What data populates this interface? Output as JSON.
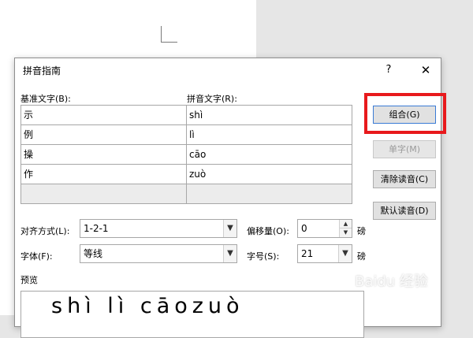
{
  "dialog": {
    "title": "拼音指南",
    "help": "?",
    "close": "✕"
  },
  "headers": {
    "base": "基准文字(B):",
    "pinyin": "拼音文字(R):"
  },
  "rows": [
    {
      "base": "示",
      "pinyin": "shì"
    },
    {
      "base": "例",
      "pinyin": "lì"
    },
    {
      "base": "操",
      "pinyin": "cāo"
    },
    {
      "base": "作",
      "pinyin": "zuò"
    },
    {
      "base": "",
      "pinyin": ""
    }
  ],
  "buttons": {
    "combine": "组合(G)",
    "single": "单字(M)",
    "clear": "清除读音(C)",
    "default": "默认读音(D)"
  },
  "form": {
    "align_label": "对齐方式(L):",
    "align_value": "1-2-1",
    "offset_label": "偏移量(O):",
    "offset_value": "0",
    "offset_unit": "磅",
    "font_label": "字体(F):",
    "font_value": "等线",
    "size_label": "字号(S):",
    "size_value": "21",
    "size_unit": "磅"
  },
  "preview": {
    "label": "预览",
    "text": "shì lì cāozuò"
  },
  "watermark": "Baidu 经验",
  "colors": {
    "highlight": "#e8191c",
    "dialog_bg": "#ffffff",
    "background": "#e6e6e6"
  }
}
